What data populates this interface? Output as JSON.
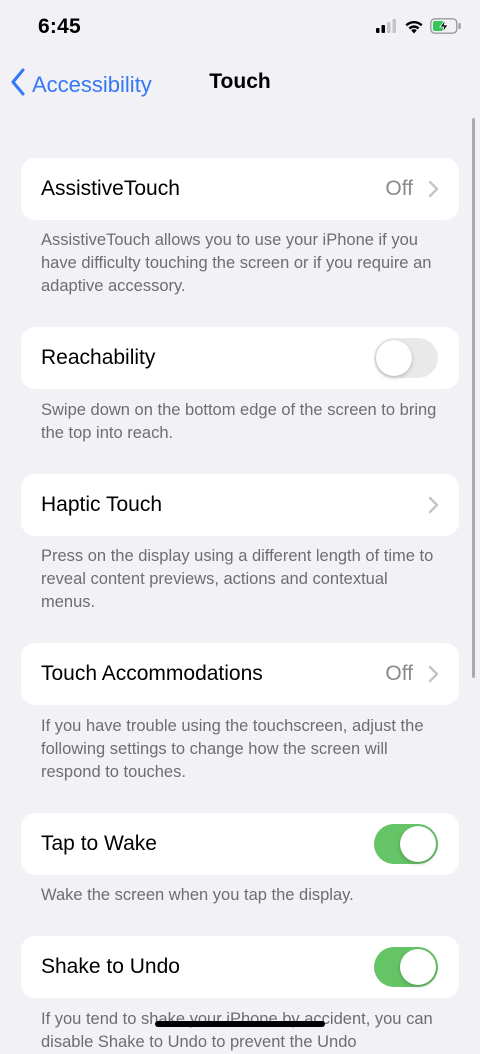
{
  "status_bar": {
    "time": "6:45",
    "icons": [
      "cellular-signal-icon",
      "wifi-icon",
      "battery-charging-icon"
    ]
  },
  "nav": {
    "back_label": "Accessibility",
    "title": "Touch",
    "back_icon": "chevron-left-icon"
  },
  "colors": {
    "accent": "#3478f6",
    "toggle_on": "#65c466",
    "toggle_off": "#e9e9ea",
    "background": "#f2f1f6",
    "secondary_text": "#6d6d72"
  },
  "settings": [
    {
      "label": "AssistiveTouch",
      "value": "Off",
      "control": "chevron",
      "footer": "AssistiveTouch allows you to use your iPhone if you have difficulty touching the screen or if you require an adaptive accessory."
    },
    {
      "label": "Reachability",
      "toggle": false,
      "control": "toggle",
      "footer": "Swipe down on the bottom edge of the screen to bring the top into reach."
    },
    {
      "label": "Haptic Touch",
      "control": "chevron",
      "footer": "Press on the display using a different length of time to reveal content previews, actions and contextual menus."
    },
    {
      "label": "Touch Accommodations",
      "value": "Off",
      "control": "chevron",
      "footer": "If you have trouble using the touchscreen, adjust the following settings to change how the screen will respond to touches."
    },
    {
      "label": "Tap to Wake",
      "toggle": true,
      "control": "toggle",
      "footer": "Wake the screen when you tap the display."
    },
    {
      "label": "Shake to Undo",
      "toggle": true,
      "control": "toggle",
      "footer": "If you tend to shake your iPhone by accident, you can disable Shake to Undo to prevent the Undo"
    }
  ]
}
